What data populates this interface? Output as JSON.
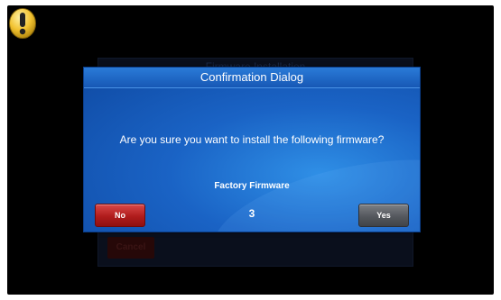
{
  "background_window": {
    "title": "Firmware Installation",
    "cancel_label": "Cancel"
  },
  "dialog": {
    "title": "Confirmation Dialog",
    "message": "Are you sure you want to install the following firmware?",
    "firmware_name": "Factory Firmware",
    "countdown": "3",
    "no_label": "No",
    "yes_label": "Yes"
  },
  "icons": {
    "warning": "warning-icon"
  },
  "colors": {
    "dialog_blue": "#1a63c5",
    "no_button_red": "#b01c1c",
    "yes_button_gray": "#55585e",
    "warning_yellow": "#f2c230"
  }
}
